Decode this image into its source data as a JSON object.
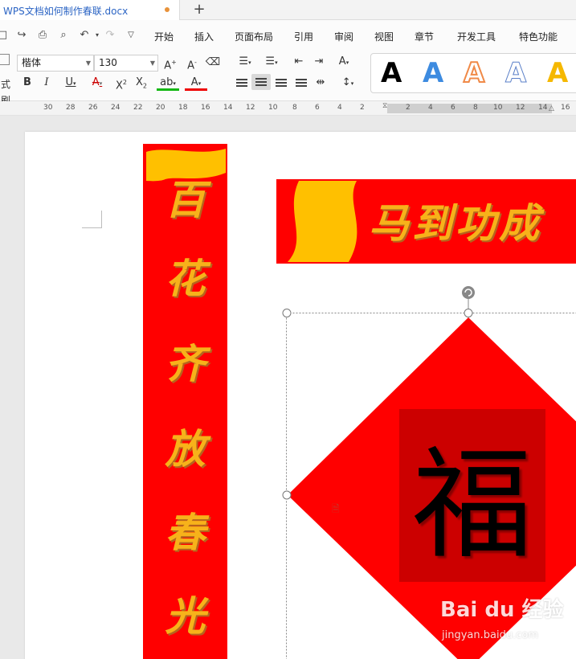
{
  "tab": {
    "title": "WPS文档如何制作春联.docx",
    "new_tab_glyph": "+"
  },
  "menu": [
    "开始",
    "插入",
    "页面布局",
    "引用",
    "审阅",
    "视图",
    "章节",
    "开发工具",
    "特色功能"
  ],
  "ribbon": {
    "font_name": "楷体",
    "font_size": "130",
    "format_painter_label": "式刷",
    "styles_letter": "A",
    "style_colors": [
      "#000000",
      "#3d8be0",
      "#f08a48",
      "#5a7fc8",
      "#f5b800"
    ]
  },
  "ruler": {
    "left_numbers": [
      "30",
      "28",
      "26",
      "24",
      "22",
      "20",
      "18",
      "16",
      "14",
      "12",
      "10",
      "8",
      "6",
      "4",
      "2"
    ],
    "right_numbers": [
      "2",
      "4",
      "6",
      "8",
      "10",
      "12",
      "14",
      "16"
    ]
  },
  "document": {
    "vertical_couplet": [
      "百",
      "花",
      "齐",
      "放",
      "春",
      "光"
    ],
    "horizontal_couplet": "马到功成",
    "fu_character": "福",
    "colors": {
      "couplet_red": "#ff0000",
      "ribbon_gold": "#ffc000",
      "text_gold": "#f7b21a",
      "fu_box": "#cc0000"
    }
  },
  "watermark": {
    "logo": "Bai du 经验",
    "url": "jingyan.baidu.com"
  }
}
